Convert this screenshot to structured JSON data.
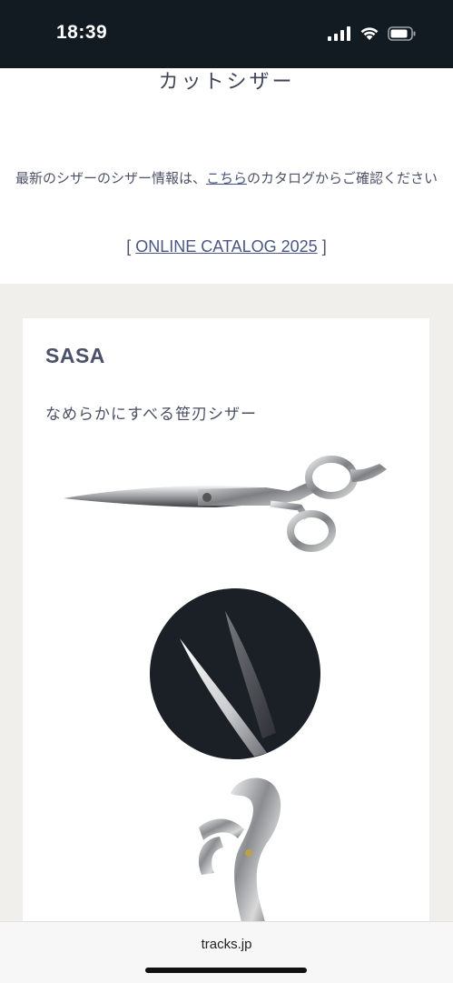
{
  "status": {
    "time": "18:39"
  },
  "page": {
    "heading": "カットシザー",
    "intro_before": "最新のシザーのシザー情報は、",
    "intro_link": "こちら",
    "intro_after": "のカタログからご確認ください",
    "catalog_open": "[ ",
    "catalog_link": "ONLINE CATALOG 2025",
    "catalog_close": " ]"
  },
  "product": {
    "name": "SASA",
    "tagline": "なめらかにすべる笹刃シザー"
  },
  "browser": {
    "url": "tracks.jp"
  }
}
